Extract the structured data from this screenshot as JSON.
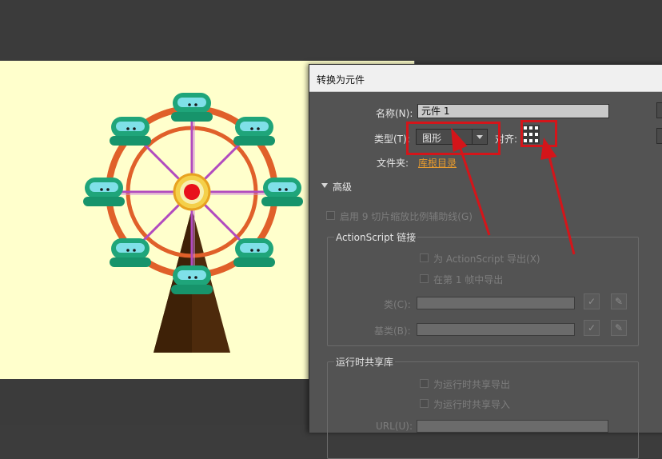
{
  "dialog": {
    "title": "转换为元件",
    "name_label": "名称(N):",
    "name_value": "元件 1",
    "type_label": "类型(T):",
    "type_value": "图形",
    "align_label": "对齐:",
    "folder_label": "文件夹:",
    "folder_value": "库根目录",
    "advanced_label": "高级",
    "nine_slice_label": "启用 9 切片缩放比例辅助线(G)",
    "as_group": {
      "title": "ActionScript 链接",
      "export_as_label": "为 ActionScript 导出(X)",
      "export_frame_label": "在第 1 帧中导出",
      "class_label": "类(C):",
      "base_class_label": "基类(B):"
    },
    "runtime_group": {
      "title": "运行时共享库",
      "export_runtime_label": "为运行时共享导出",
      "import_runtime_label": "为运行时共享导入",
      "url_label": "URL(U):"
    }
  },
  "annotation": {
    "highlight_color": "#d4151a"
  },
  "canvas": {
    "background": "#ffffcc"
  }
}
